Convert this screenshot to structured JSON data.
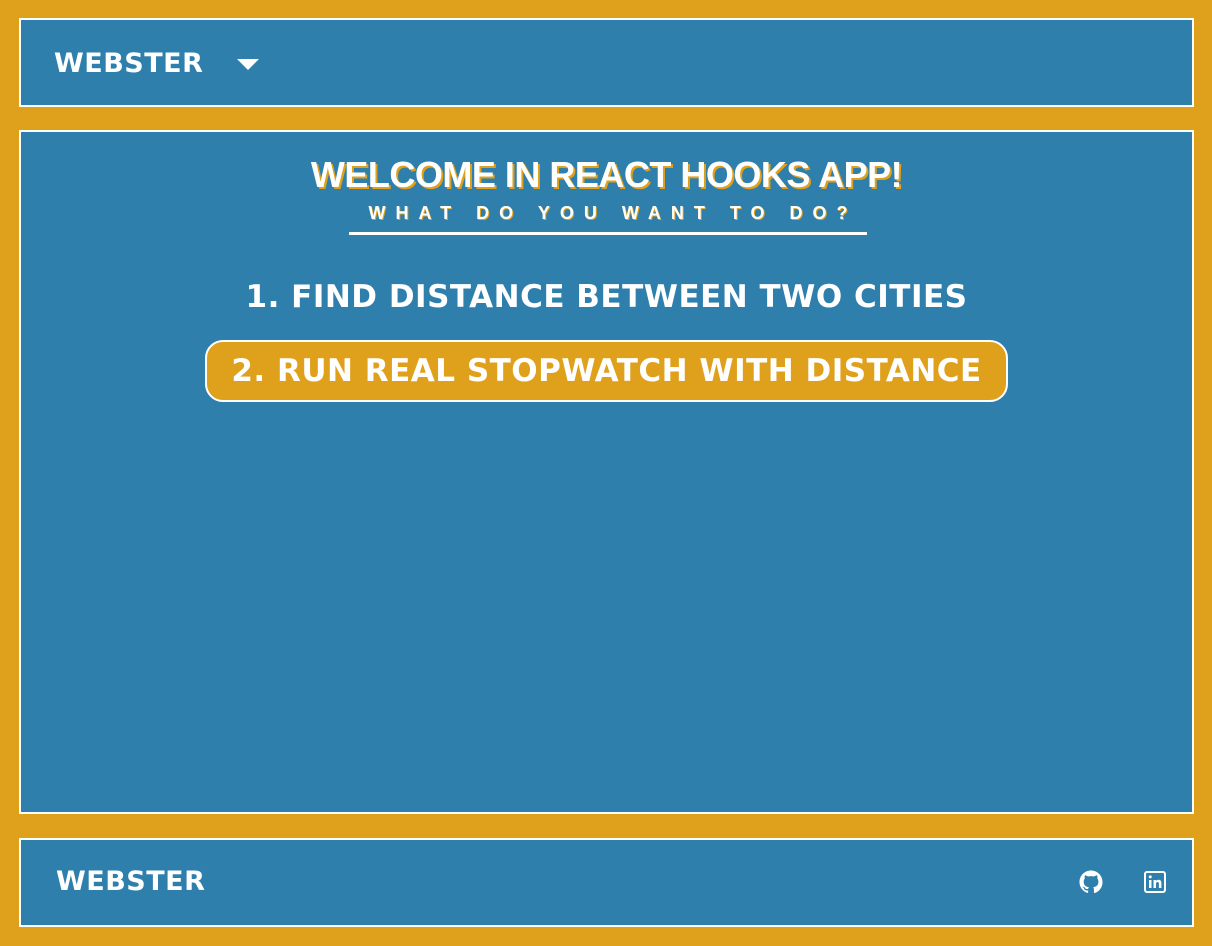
{
  "header": {
    "brand": "WEBSTER",
    "menu_icon": "caret-down-icon"
  },
  "main": {
    "title": "WELCOME IN REACT HOOKS APP!",
    "subtitle": "WHAT DO YOU WANT TO DO?",
    "options": [
      {
        "label": "1. FIND DISTANCE BETWEEN TWO CITIES",
        "active": false
      },
      {
        "label": "2. RUN REAL STOPWATCH WITH DISTANCE",
        "active": true
      }
    ]
  },
  "footer": {
    "brand": "WEBSTER",
    "icons": [
      "github-icon",
      "linkedin-icon"
    ]
  },
  "colors": {
    "background": "#DFA11B",
    "panel": "#2F7FAD",
    "border": "#FFFFFF",
    "accent": "#DFA11B"
  }
}
